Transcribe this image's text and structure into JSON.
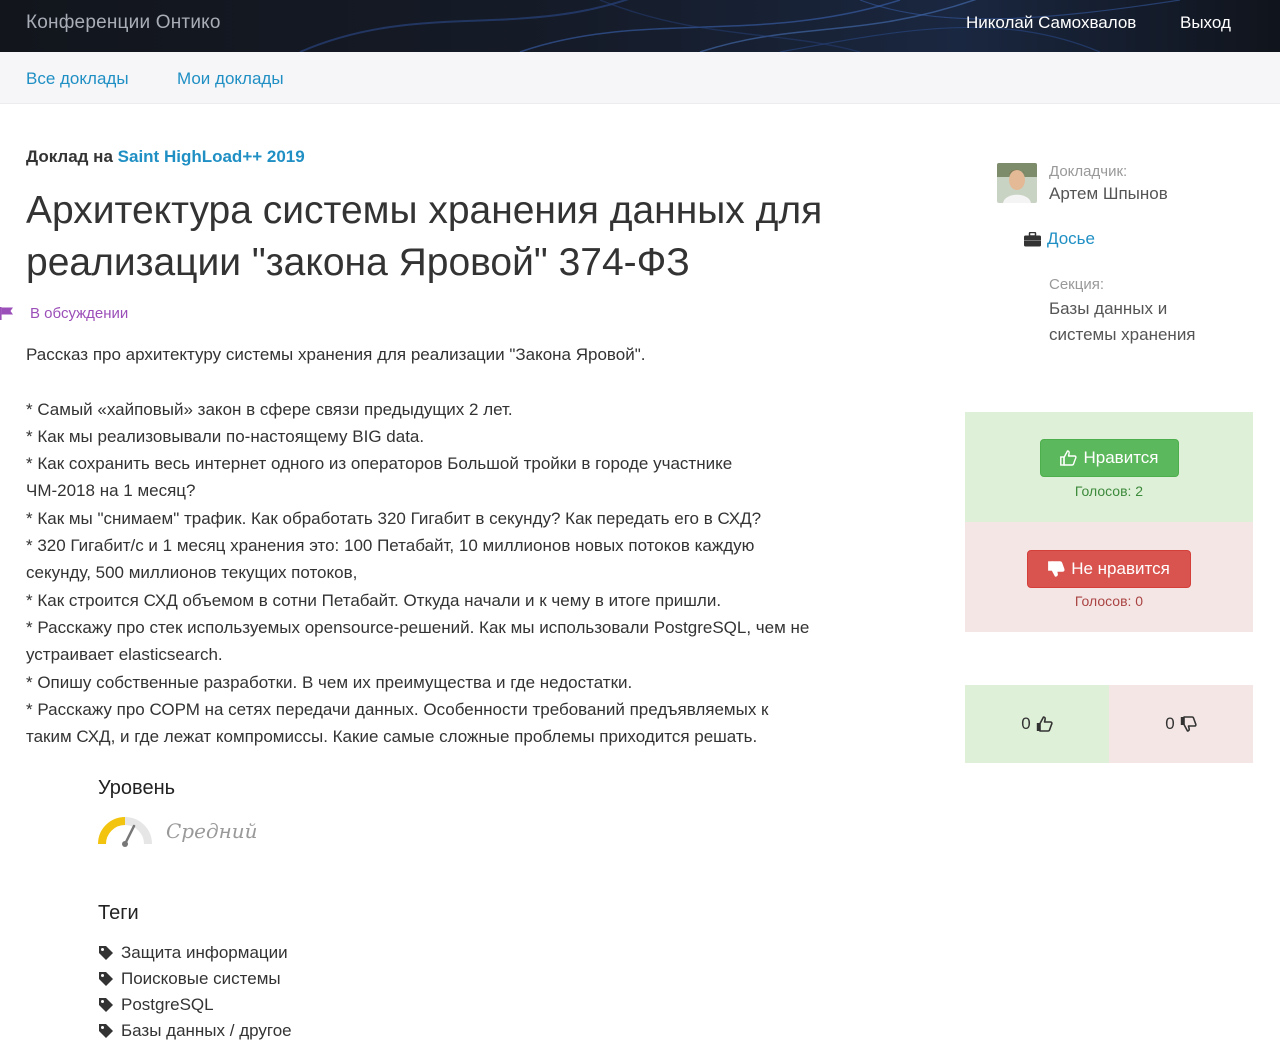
{
  "header": {
    "brand": "Конференции Онтико",
    "user_name": "Николай Самохвалов",
    "logout": "Выход"
  },
  "subnav": {
    "all_talks": "Все доклады",
    "my_talks": "Мои доклады"
  },
  "talk": {
    "prefix": "Доклад на",
    "conference": "Saint HighLoad++ 2019",
    "title": "Архитектура системы хранения данных для реализации \"закона Яровой\" 374-ФЗ",
    "status": "В обсуждении",
    "description": "Рассказ про архитектуру системы хранения для реализации \"Закона Яровой\".\n\n* Самый «хайповый» закон в сфере связи предыдущих 2 лет.\n* Как мы реализовывали по-настоящему BIG data.\n* Как сохранить весь интернет одного из операторов Большой тройки в городе участнике\nЧМ-2018 на 1 месяц?\n* Как мы \"снимаем\" трафик. Как обработать 320 Гигабит в секунду? Как передать его в СХД?\n* 320 Гигабит/с и 1 месяц хранения это: 100 Петабайт, 10 миллионов новых потоков каждую\nсекунду, 500 миллионов текущих потоков,\n* Как строится СХД объемом в сотни Петабайт. Откуда начали и к чему в итоге пришли.\n* Расскажу про стек используемых opensource-решений. Как мы использовали PostgreSQL, чем не\nустраивает elasticsearch.\n* Опишу собственные разработки. В чем их преимущества и где недостатки.\n* Расскажу про СОРМ на сетях передачи данных. Особенности требований предъявляемых к\nтаким СХД, и где лежат компромиссы. Какие самые сложные проблемы приходится решать."
  },
  "level": {
    "heading": "Уровень",
    "value": "Средний"
  },
  "tags": {
    "heading": "Теги",
    "items": [
      "Защита информации",
      "Поисковые системы",
      "PostgreSQL",
      "Базы данных / другое"
    ]
  },
  "sidebar": {
    "speaker_caption": "Докладчик:",
    "speaker_name": "Артем Шпынов",
    "dossier": "Досье",
    "section_caption": "Секция:",
    "section_name": "Базы данных и системы хранения"
  },
  "voting": {
    "like_label": "Нравится",
    "like_votes": "Голосов: 2",
    "dislike_label": "Не нравится",
    "dislike_votes": "Голосов: 0",
    "counter_up": "0",
    "counter_down": "0"
  },
  "colors": {
    "link": "#1f8fc4",
    "status": "#9b4fb8",
    "like": "#5cb85c",
    "dislike": "#d9534f"
  }
}
